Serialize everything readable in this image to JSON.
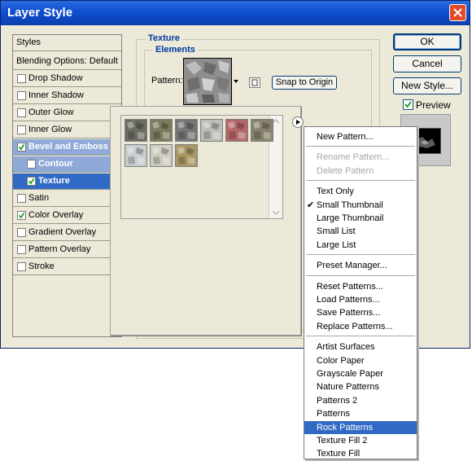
{
  "window": {
    "title": "Layer Style"
  },
  "styles_list": [
    {
      "label": "Styles",
      "type": "header"
    },
    {
      "label": "Blending Options: Default",
      "type": "header"
    },
    {
      "label": "Drop Shadow",
      "checked": false
    },
    {
      "label": "Inner Shadow",
      "checked": false
    },
    {
      "label": "Outer Glow",
      "checked": false
    },
    {
      "label": "Inner Glow",
      "checked": false
    },
    {
      "label": "Bevel and Emboss",
      "checked": true,
      "state": "selected-light"
    },
    {
      "label": "Contour",
      "checked": false,
      "sub": true,
      "state": "selected-light"
    },
    {
      "label": "Texture",
      "checked": true,
      "sub": true,
      "state": "selected"
    },
    {
      "label": "Satin",
      "checked": false
    },
    {
      "label": "Color Overlay",
      "checked": true
    },
    {
      "label": "Gradient Overlay",
      "checked": false
    },
    {
      "label": "Pattern Overlay",
      "checked": false
    },
    {
      "label": "Stroke",
      "checked": false
    }
  ],
  "texture_group": {
    "title": "Texture",
    "elements_title": "Elements",
    "pattern_label": "Pattern:",
    "snap_button": "Snap to Origin"
  },
  "buttons": {
    "ok": "OK",
    "cancel": "Cancel",
    "new_style": "New Style...",
    "preview": "Preview",
    "preview_checked": true
  },
  "pattern_thumbs": [
    {
      "color": "#6d6c63"
    },
    {
      "color": "#7e7a5e"
    },
    {
      "color": "#767676"
    },
    {
      "color": "#bdbdb8"
    },
    {
      "color": "#b46767"
    },
    {
      "color": "#86826c"
    },
    {
      "color": "#c8cdd0"
    },
    {
      "color": "#cfcdc2"
    },
    {
      "color": "#a99866"
    }
  ],
  "menu": {
    "items": [
      {
        "label": "New Pattern...",
        "group": 0
      },
      {
        "label": "Rename Pattern...",
        "group": 1,
        "disabled": true
      },
      {
        "label": "Delete Pattern",
        "group": 1,
        "disabled": true
      },
      {
        "label": "Text Only",
        "group": 2
      },
      {
        "label": "Small Thumbnail",
        "group": 2,
        "checked": true
      },
      {
        "label": "Large Thumbnail",
        "group": 2
      },
      {
        "label": "Small List",
        "group": 2
      },
      {
        "label": "Large List",
        "group": 2
      },
      {
        "label": "Preset Manager...",
        "group": 3
      },
      {
        "label": "Reset Patterns...",
        "group": 4
      },
      {
        "label": "Load Patterns...",
        "group": 4
      },
      {
        "label": "Save Patterns...",
        "group": 4
      },
      {
        "label": "Replace Patterns...",
        "group": 4
      },
      {
        "label": "Artist Surfaces",
        "group": 5
      },
      {
        "label": "Color Paper",
        "group": 5
      },
      {
        "label": "Grayscale Paper",
        "group": 5
      },
      {
        "label": "Nature Patterns",
        "group": 5
      },
      {
        "label": "Patterns 2",
        "group": 5
      },
      {
        "label": "Patterns",
        "group": 5
      },
      {
        "label": "Rock Patterns",
        "group": 5,
        "highlighted": true
      },
      {
        "label": "Texture Fill 2",
        "group": 5
      },
      {
        "label": "Texture Fill",
        "group": 5
      }
    ]
  },
  "colors": {
    "title_bar": "#0f4fcf",
    "selection": "#316ac5",
    "selection_light": "#8fa9d9",
    "dialog_bg": "#ece9d8"
  }
}
